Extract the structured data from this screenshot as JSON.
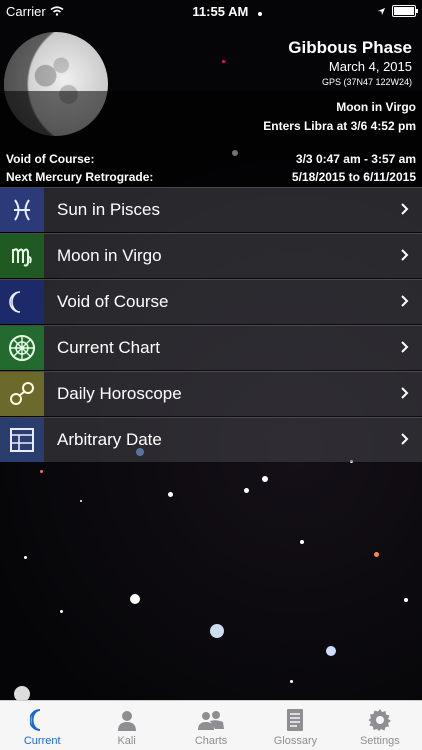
{
  "status_bar": {
    "carrier": "Carrier",
    "time": "11:55 AM"
  },
  "phase": {
    "title": "Gibbous Phase",
    "date": "March 4, 2015",
    "gps": "GPS (37N47 122W24)"
  },
  "moon_sign": {
    "line1": "Moon in Virgo",
    "line2": "Enters Libra at 3/6 4:52 pm"
  },
  "void_of_course": {
    "label": "Void of Course:",
    "value": "3/3 0:47 am - 3:57 am"
  },
  "mercury_retrograde": {
    "label": "Next Mercury Retrograde:",
    "value": "5/18/2015 to 6/11/2015"
  },
  "menu": [
    {
      "label": "Sun in Pisces",
      "icon": "pisces-icon",
      "color": "#2c3a7a"
    },
    {
      "label": "Moon in Virgo",
      "icon": "virgo-icon",
      "color": "#1f5a22"
    },
    {
      "label": "Void of Course",
      "icon": "crescent-moon-icon",
      "color": "#1d2a6a"
    },
    {
      "label": "Current Chart",
      "icon": "wheel-chart-icon",
      "color": "#226a2e"
    },
    {
      "label": "Daily Horoscope",
      "icon": "linked-circles-icon",
      "color": "#6c6a2a"
    },
    {
      "label": "Arbitrary Date",
      "icon": "calendar-grid-icon",
      "color": "#2b3d6e"
    }
  ],
  "tabs": [
    {
      "label": "Current",
      "icon": "crescent-moon-icon",
      "active": true
    },
    {
      "label": "Kali",
      "icon": "person-icon",
      "active": false
    },
    {
      "label": "Charts",
      "icon": "people-icon",
      "active": false
    },
    {
      "label": "Glossary",
      "icon": "book-icon",
      "active": false
    },
    {
      "label": "Settings",
      "icon": "gear-icon",
      "active": false
    }
  ]
}
